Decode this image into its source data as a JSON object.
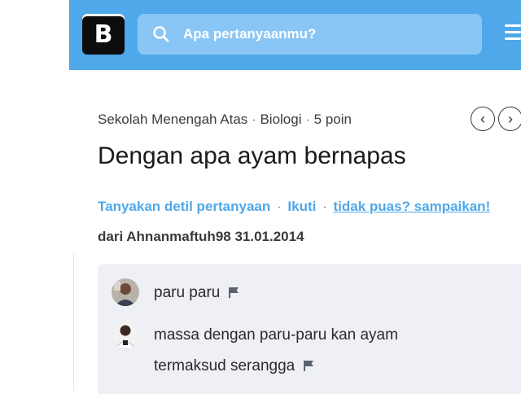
{
  "header": {
    "logo_letter": "B",
    "search_placeholder": "Apa pertanyaanmu?",
    "brand_color": "#4fa8ea"
  },
  "question": {
    "meta": {
      "level": "Sekolah Menengah Atas",
      "subject": "Biologi",
      "points": "5 poin",
      "separator": "·"
    },
    "title": "Dengan apa ayam bernapas",
    "actions": {
      "ask_details": "Tanyakan detil pertanyaan",
      "follow": "Ikuti",
      "report": "tidak puas? sampaikan!",
      "separator": "·"
    },
    "author_line": "dari Ahnanmaftuh98 31.01.2014"
  },
  "nav": {
    "prev_icon": "chevron-left-icon",
    "next_icon": "chevron-right-icon",
    "prev_glyph": "‹",
    "next_glyph": "›"
  },
  "comments": [
    {
      "text": "paru paru"
    },
    {
      "line1": "massa dengan paru-paru kan ayam",
      "line2": "termaksud serangga"
    }
  ]
}
